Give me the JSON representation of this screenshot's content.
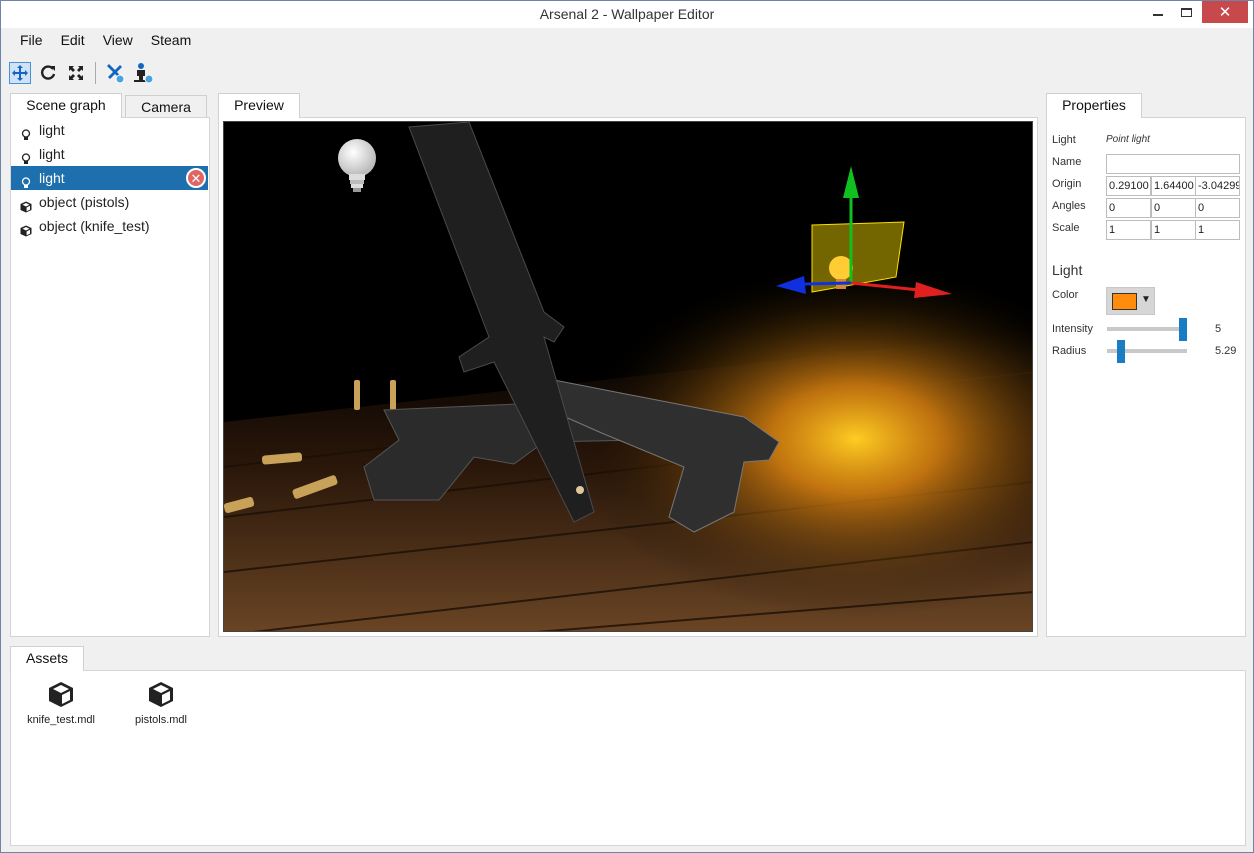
{
  "window": {
    "title": "Arsenal 2 - Wallpaper Editor"
  },
  "menu": [
    "File",
    "Edit",
    "View",
    "Steam"
  ],
  "toolbar": {
    "tools": [
      "move-tool-icon",
      "rotate-tool-icon",
      "scale-tool-icon",
      "add-light-icon",
      "add-object-icon"
    ]
  },
  "left_tabs": {
    "scene_graph": "Scene graph",
    "camera": "Camera"
  },
  "scene_items": [
    {
      "label": "light",
      "icon": "bulb-icon"
    },
    {
      "label": "light",
      "icon": "bulb-icon"
    },
    {
      "label": "light",
      "icon": "bulb-icon",
      "selected": true
    },
    {
      "label": "object (pistols)",
      "icon": "cube-icon"
    },
    {
      "label": "object (knife_test)",
      "icon": "cube-icon"
    }
  ],
  "preview": {
    "tab": "Preview"
  },
  "properties": {
    "tab": "Properties",
    "light_label": "Light",
    "light_type": "Point light",
    "name_label": "Name",
    "name_value": "",
    "origin_label": "Origin",
    "origin": [
      "0.29100",
      "1.64400",
      "-3.04299"
    ],
    "angles_label": "Angles",
    "angles": [
      "0",
      "0",
      "0"
    ],
    "scale_label": "Scale",
    "scale": [
      "1",
      "1",
      "1"
    ],
    "section_light": "Light",
    "color_label": "Color",
    "color_value": "#ff8c0a",
    "intensity_label": "Intensity",
    "intensity_value": "5",
    "intensity_fraction": 0.95,
    "radius_label": "Radius",
    "radius_value": "5.29",
    "radius_fraction": 0.18
  },
  "assets": {
    "tab": "Assets",
    "items": [
      {
        "label": "knife_test.mdl",
        "icon": "cube-icon"
      },
      {
        "label": "pistols.mdl",
        "icon": "cube-icon"
      }
    ]
  },
  "colors": {
    "selection": "#1e6fad",
    "slider": "#1a7dc4",
    "close": "#c7494b"
  }
}
